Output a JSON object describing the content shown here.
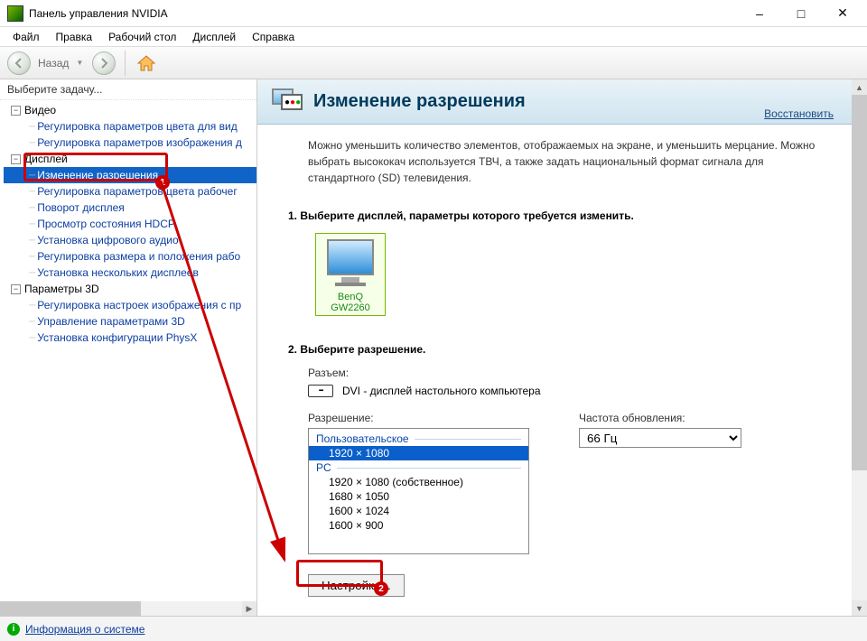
{
  "app": {
    "title": "Панель управления NVIDIA"
  },
  "menu": [
    "Файл",
    "Правка",
    "Рабочий стол",
    "Дисплей",
    "Справка"
  ],
  "toolbar": {
    "back_label": "Назад"
  },
  "sidebar": {
    "header": "Выберите задачу...",
    "groups": [
      {
        "label": "Видео",
        "items": [
          "Регулировка параметров цвета для вид",
          "Регулировка параметров изображения д"
        ]
      },
      {
        "label": "Дисплей",
        "items": [
          "Изменение разрешения",
          "Регулировка параметров цвета рабочег",
          "Поворот дисплея",
          "Просмотр состояния HDCP",
          "Установка цифрового аудио",
          "Регулировка размера и положения рабо",
          "Установка нескольких дисплеев"
        ],
        "selected_index": 0
      },
      {
        "label": "Параметры 3D",
        "items": [
          "Регулировка настроек изображения с пр",
          "Управление параметрами 3D",
          "Установка конфигурации PhysX"
        ]
      }
    ]
  },
  "footer": {
    "system_info": "Информация о системе"
  },
  "page": {
    "title": "Изменение разрешения",
    "restore": "Восстановить",
    "intro": "Можно уменьшить количество элементов, отображаемых на экране, и уменьшить мерцание. Можно выбрать высококач используется ТВЧ, а также задать национальный формат сигнала для стандартного (SD) телевидения.",
    "step1": "1. Выберите дисплей, параметры которого требуется изменить.",
    "monitor_name": "BenQ GW2260",
    "step2": "2. Выберите разрешение.",
    "connector_label": "Разъем:",
    "connector_value": "DVI - дисплей настольного компьютера",
    "resolution_label": "Разрешение:",
    "resolution_list": {
      "groups": [
        {
          "label": "Пользовательское",
          "items": [
            "1920 × 1080"
          ]
        },
        {
          "label": "PC",
          "items": [
            "1920 × 1080 (собственное)",
            "1680 × 1050",
            "1600 × 1024",
            "1600 × 900"
          ]
        }
      ],
      "selected": "1920 × 1080"
    },
    "refresh_label": "Частота обновления:",
    "refresh_value": "66 Гц",
    "settings_btn": "Настройка..."
  }
}
